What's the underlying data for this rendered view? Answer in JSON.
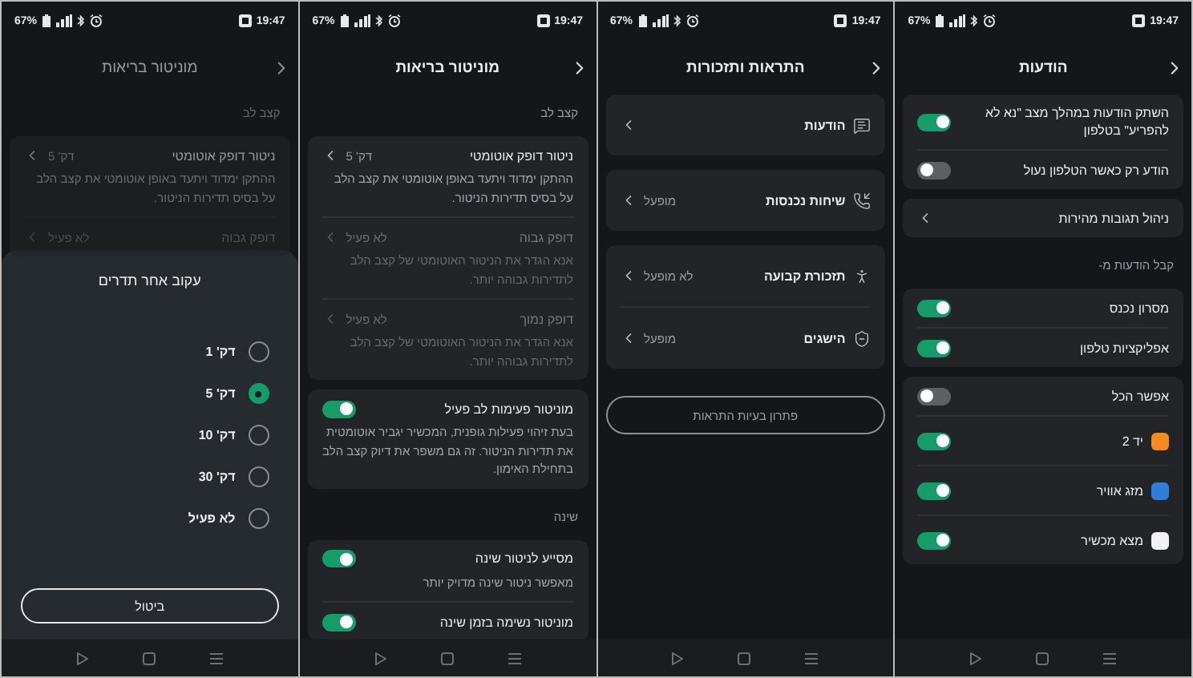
{
  "screens": [
    {
      "kind": "settings",
      "status": {
        "battery": "67%",
        "time": "19:47"
      },
      "title": "הודעות",
      "blocks": [
        {
          "kind": "card",
          "rows": [
            {
              "kind": "toggle",
              "title": "השתק הודעות במהלך מצב \"נא לא להפריע\" בטלפון",
              "on": true
            },
            {
              "kind": "toggle",
              "title": "הודע רק כאשר הטלפון נעול",
              "on": false
            }
          ]
        },
        {
          "kind": "card",
          "rows": [
            {
              "kind": "link",
              "title": "ניהול תגובות מהירות",
              "disabled": false
            }
          ]
        },
        {
          "kind": "section",
          "label": "קבל הודעות מ-"
        },
        {
          "kind": "card",
          "rows": [
            {
              "kind": "toggle",
              "title": "מסרון נכנס",
              "on": true
            },
            {
              "kind": "toggle",
              "title": "אפליקציות טלפון",
              "on": true
            }
          ]
        },
        {
          "kind": "card",
          "rows": [
            {
              "kind": "toggle",
              "title": "אפשר הכל",
              "on": false
            },
            {
              "kind": "app",
              "title": "יד 2",
              "color": "#f58a1f",
              "on": true
            },
            {
              "kind": "app",
              "title": "מזג אוויר",
              "color": "#2f7fd8",
              "on": true
            },
            {
              "kind": "app",
              "title": "מצא מכשיר",
              "color": "#f2f2f2",
              "on": true
            }
          ]
        }
      ]
    },
    {
      "kind": "menu",
      "status": {
        "battery": "67%",
        "time": "19:47"
      },
      "title": "התראות ותזכורות",
      "blocks": [
        {
          "kind": "card",
          "rows": [
            {
              "kind": "link",
              "title": "הודעות",
              "disabled": false
            }
          ]
        },
        {
          "kind": "card",
          "rows": [
            {
              "kind": "link",
              "title": "שיחות נכנסות",
              "value": "מופעל",
              "disabled": false
            }
          ]
        },
        {
          "kind": "card",
          "rows": [
            {
              "kind": "link",
              "title": "תזכורת קבועה",
              "value": "לא מופעל",
              "disabled": false
            },
            {
              "kind": "link",
              "title": "הישגים",
              "value": "מופעל",
              "disabled": false
            }
          ]
        },
        {
          "kind": "button",
          "label": "פתרון בעיות התראות"
        }
      ]
    },
    {
      "kind": "settings",
      "status": {
        "battery": "67%",
        "time": "19:47"
      },
      "title": "מוניטור בריאות",
      "blocks": [
        {
          "kind": "section",
          "label": "קצב לב"
        },
        {
          "kind": "card",
          "rows": [
            {
              "kind": "link",
              "title": "ניטור דופק אוטומטי",
              "value": "דק' 5",
              "desc": "ההתקן ימדוד ויתעד באופן אוטומטי את קצב הלב על בסיס תדירות הניטור.",
              "disabled": false
            },
            {
              "kind": "link",
              "title": "דופק גבוה",
              "value": "לא פעיל",
              "desc": "אנא הגדר את הניטור האוטומטי של קצב הלב לתדירות גבוהה יותר.",
              "disabled": true
            },
            {
              "kind": "link",
              "title": "דופק נמוך",
              "value": "לא פעיל",
              "desc": "אנא הגדר את הניטור האוטומטי של קצב הלב לתדירות גבוהה יותר.",
              "disabled": true
            }
          ]
        },
        {
          "kind": "card",
          "rows": [
            {
              "kind": "toggle",
              "title": "מוניטור פעימות לב פעיל",
              "desc": "בעת זיהוי פעילות גופנית, המכשיר יגביר אוטומטית את תדירות הניטור. זה גם משפר את דיוק קצב הלב בתחילת האימון.",
              "on": true
            }
          ]
        },
        {
          "kind": "section",
          "label": "שינה"
        },
        {
          "kind": "card",
          "rows": [
            {
              "kind": "toggle",
              "title": "מסייע לניטור שינה",
              "desc": "מאפשר ניטור שינה מדויק יותר",
              "on": true
            },
            {
              "kind": "toggle",
              "title": "מוניטור נשימה בזמן שינה",
              "on": true
            }
          ]
        }
      ]
    },
    {
      "kind": "sheet",
      "status": {
        "battery": "67%",
        "time": "19:47"
      },
      "title": "מוניטור בריאות",
      "blocks": [
        {
          "kind": "section",
          "label": "קצב לב"
        },
        {
          "kind": "card",
          "rows": [
            {
              "kind": "link",
              "title": "ניטור דופק אוטומטי",
              "value": "דק' 5",
              "desc": "ההתקן ימדוד ויתעד באופן אוטומטי את קצב הלב על בסיס תדירות הניטור.",
              "disabled": false
            },
            {
              "kind": "link",
              "title": "דופק גבוה",
              "value": "לא פעיל",
              "disabled": true
            }
          ]
        }
      ],
      "sheet": {
        "title": "עקוב אחר תדרים",
        "options": [
          {
            "label": "דק' 1",
            "selected": false
          },
          {
            "label": "דק' 5",
            "selected": true
          },
          {
            "label": "דק' 10",
            "selected": false
          },
          {
            "label": "דק' 30",
            "selected": false
          },
          {
            "label": "לא פעיל",
            "selected": false
          }
        ],
        "cancel": "ביטול"
      }
    }
  ]
}
